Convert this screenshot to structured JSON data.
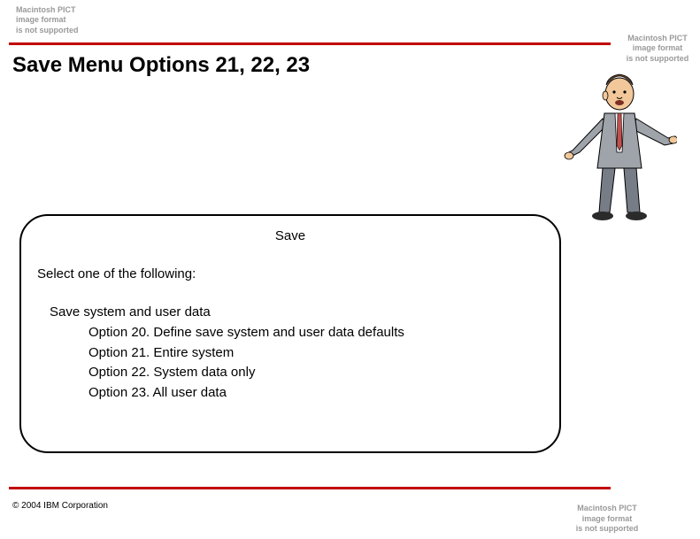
{
  "pict_notice": {
    "line1": "Macintosh PICT",
    "line2": "image format",
    "line3": "is not supported"
  },
  "title": "Save Menu Options 21, 22, 23",
  "menu": {
    "heading": "Save",
    "prompt": "Select one of the following:",
    "section": "Save system and user data",
    "options": [
      "Option 20. Define save system and user data defaults",
      "Option 21. Entire system",
      "Option 22. System data only",
      "Option 23. All user data"
    ]
  },
  "footer": "© 2004 IBM Corporation"
}
